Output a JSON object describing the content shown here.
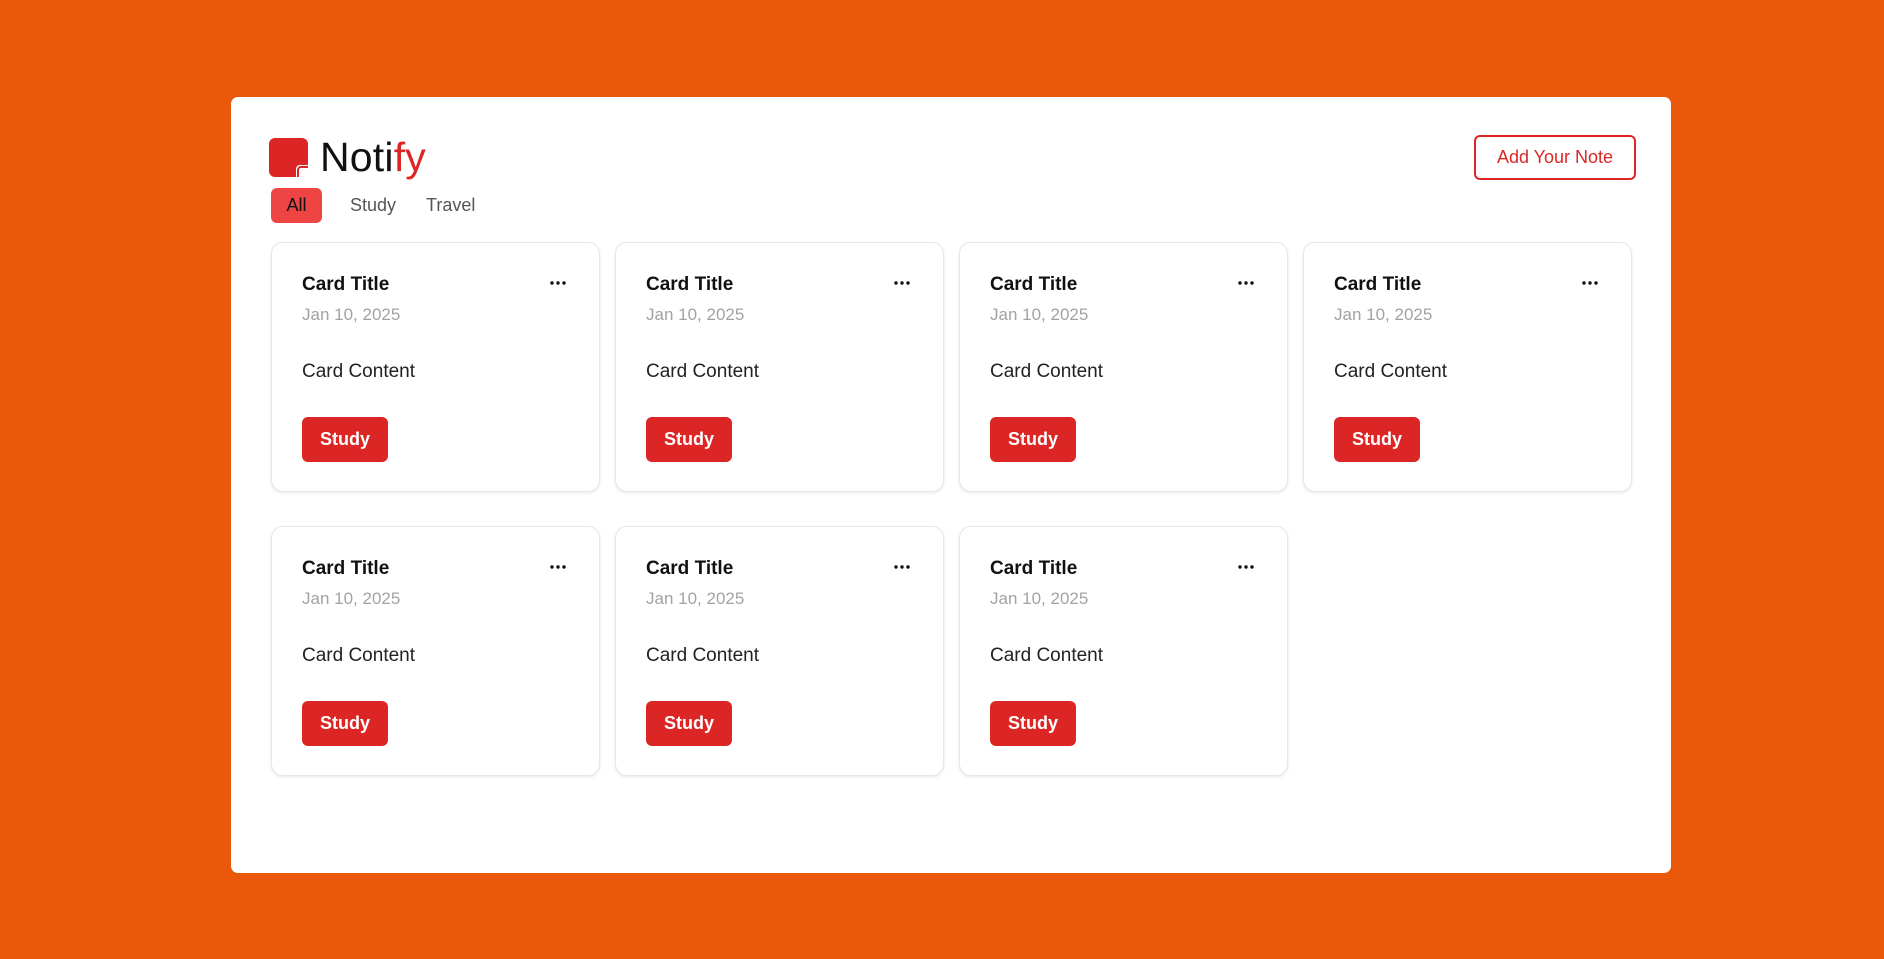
{
  "app": {
    "brand_prefix": "Noti",
    "brand_suffix": "fy",
    "add_note_label": "Add Your Note"
  },
  "tabs": [
    {
      "label": "All",
      "active": true
    },
    {
      "label": "Study",
      "active": false
    },
    {
      "label": "Travel",
      "active": false
    }
  ],
  "cards": [
    {
      "title": "Card Title",
      "date": "Jan 10, 2025",
      "content": "Card Content",
      "tag": "Study"
    },
    {
      "title": "Card Title",
      "date": "Jan 10, 2025",
      "content": "Card Content",
      "tag": "Study"
    },
    {
      "title": "Card Title",
      "date": "Jan 10, 2025",
      "content": "Card Content",
      "tag": "Study"
    },
    {
      "title": "Card Title",
      "date": "Jan 10, 2025",
      "content": "Card Content",
      "tag": "Study"
    },
    {
      "title": "Card Title",
      "date": "Jan 10, 2025",
      "content": "Card Content",
      "tag": "Study"
    },
    {
      "title": "Card Title",
      "date": "Jan 10, 2025",
      "content": "Card Content",
      "tag": "Study"
    },
    {
      "title": "Card Title",
      "date": "Jan 10, 2025",
      "content": "Card Content",
      "tag": "Study"
    }
  ],
  "icons": {
    "logo": "sticky-note-icon",
    "card_menu": "more-horizontal-icon"
  },
  "colors": {
    "background": "#ea580c",
    "accent": "#dc2626",
    "active_tab": "#ef4444"
  }
}
